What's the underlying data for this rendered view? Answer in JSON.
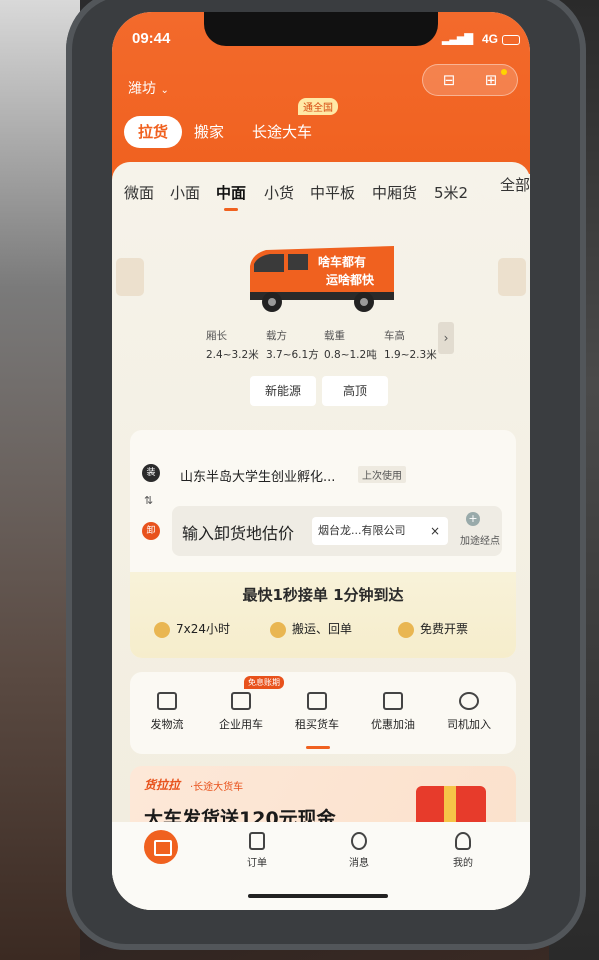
{
  "status_bar": {
    "time": "09:44",
    "network": "4G"
  },
  "header": {
    "city": "潍坊",
    "scan_icon": "scan-icon",
    "gift_icon": "gift-icon"
  },
  "main_tabs": [
    {
      "label": "拉货",
      "active": true
    },
    {
      "label": "搬家",
      "active": false
    },
    {
      "label": "长途大车",
      "active": false,
      "badge": "通全国"
    }
  ],
  "vehicle_tabs": [
    "微面",
    "小面",
    "中面",
    "小货",
    "中平板",
    "中厢货",
    "5米2"
  ],
  "vehicle_tabs_active": "中面",
  "vehicle_all": "全部",
  "vehicle": {
    "slogan_line1": "啥车都有",
    "slogan_line2": "运啥都快",
    "specs": [
      {
        "label": "厢长",
        "value": "2.4~3.2米"
      },
      {
        "label": "载方",
        "value": "3.7~6.1方"
      },
      {
        "label": "载重",
        "value": "0.8~1.2吨"
      },
      {
        "label": "车高",
        "value": "1.9~2.3米"
      }
    ],
    "options": [
      "新能源",
      "高顶"
    ]
  },
  "route": {
    "from_tag": "装",
    "from_address": "山东半岛大学生创业孵化...",
    "from_hint": "上次使用",
    "to_tag": "卸",
    "to_placeholder": "输入卸货地估价",
    "suggestion": "烟台龙...有限公司",
    "add_stop": "加途经点"
  },
  "promo": {
    "slogan": "最快1秒接单 1分钟到达",
    "features": [
      "7x24小时",
      "搬运、回单",
      "免费开票"
    ]
  },
  "services": [
    {
      "label": "发物流",
      "icon": "parcel-icon"
    },
    {
      "label": "企业用车",
      "icon": "building-icon",
      "badge": "免息账期"
    },
    {
      "label": "租买货车",
      "icon": "truck-icon"
    },
    {
      "label": "优惠加油",
      "icon": "fuel-icon"
    },
    {
      "label": "司机加入",
      "icon": "driver-icon"
    }
  ],
  "banner": {
    "brand": "货拉拉",
    "brand_sub": "·长途大货车",
    "title": "大车发货送120元现金"
  },
  "tabbar": [
    {
      "label": "",
      "icon": "home-truck-icon",
      "active": true
    },
    {
      "label": "订单",
      "icon": "order-icon"
    },
    {
      "label": "消息",
      "icon": "message-icon"
    },
    {
      "label": "我的",
      "icon": "profile-icon"
    }
  ],
  "colors": {
    "accent": "#f0611f",
    "header_bg": "#f36a2c",
    "content_bg": "#f6f3ea"
  }
}
